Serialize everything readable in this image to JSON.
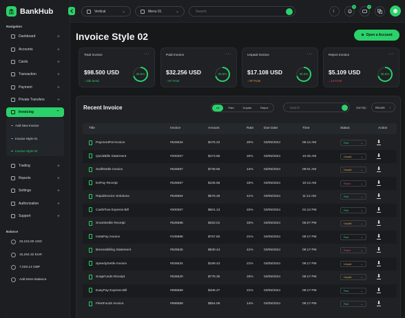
{
  "app": {
    "brand": "BankHub"
  },
  "sidebar": {
    "nav_title": "Navigation",
    "items": [
      {
        "label": "Dashboard",
        "icon": "dashboard-icon"
      },
      {
        "label": "Accounts",
        "icon": "accounts-icon"
      },
      {
        "label": "Cards",
        "icon": "card-icon"
      },
      {
        "label": "Transaction",
        "icon": "transaction-icon"
      },
      {
        "label": "Payment",
        "icon": "payment-icon"
      },
      {
        "label": "Private Transfers",
        "icon": "transfer-icon"
      },
      {
        "label": "Invoicing",
        "icon": "invoice-icon",
        "active": true
      },
      {
        "label": "Trading",
        "icon": "trading-icon"
      },
      {
        "label": "Reports",
        "icon": "reports-icon"
      },
      {
        "label": "Settings",
        "icon": "settings-icon"
      },
      {
        "label": "Authorization",
        "icon": "authorization-icon"
      },
      {
        "label": "Support",
        "icon": "support-icon"
      }
    ],
    "sub_items": [
      {
        "label": "Add New Invoice"
      },
      {
        "label": "Invoice Style 01"
      },
      {
        "label": "Invoice Style 02",
        "active": true
      }
    ],
    "balance_title": "Balance",
    "balances": [
      "33,215.00 USD",
      "15,254.32 EUR",
      "7,029.14 GBP"
    ],
    "add_balance": "Add More Balance"
  },
  "topbar": {
    "view_select": "Vertical",
    "menu_select": "Menu 01",
    "search_placeholder": "Search",
    "notif_count": "5",
    "msg_count": "4"
  },
  "page": {
    "title": "Invoice Style 02",
    "open_account": "Open a Account"
  },
  "cards": [
    {
      "title": "Total Invoice",
      "value": "$98.500 USD",
      "sub": "↑ 23k Send",
      "sub_color": "#2bd16a",
      "pct": "35.5%"
    },
    {
      "title": "Paid Invoice",
      "value": "$32.256 USD",
      "sub": "↑ 97 From",
      "sub_color": "#2bd16a",
      "pct": "35.5%"
    },
    {
      "title": "Unpaid Invoice",
      "value": "$17.108 USD",
      "sub": "↕ 97 From",
      "sub_color": "#e8a33a",
      "pct": "35.5%"
    },
    {
      "title": "Reject Invoice",
      "value": "$5.109 USD",
      "sub": "↓ 14 From",
      "sub_color": "#e5484d",
      "pct": "35.5%"
    }
  ],
  "recent": {
    "title": "Recent Invoice",
    "filters": [
      "All",
      "Paid",
      "Unpaid",
      "Reject"
    ],
    "search_placeholder": "Search",
    "sort_label": "Sort By :",
    "sort_value": "Recent",
    "columns": [
      "Title",
      "Invoice",
      "Amount",
      "Rate",
      "Due Date",
      "Time",
      "Status",
      "Action"
    ],
    "rows": [
      {
        "title": "PaymentPal Invoice",
        "invoice": "#526534",
        "amount": "$475.22",
        "rate": "20%",
        "due": "03/05/2024",
        "time": "05:12 AM",
        "status": "Paid"
      },
      {
        "title": "QuickBills Statement",
        "invoice": "#200257",
        "amount": "$473.85",
        "rate": "20%",
        "due": "03/05/2024",
        "time": "10:45 AM",
        "status": "Unpaid"
      },
      {
        "title": "SwiftSettle Invoice",
        "invoice": "#526587",
        "amount": "$739.65",
        "rate": "14%",
        "due": "03/05/2024",
        "time": "09:01 AM",
        "status": "Unpaid"
      },
      {
        "title": "E2Pay Receipt",
        "invoice": "#526587",
        "amount": "$106.58",
        "rate": "33%",
        "due": "03/05/2024",
        "time": "10:12 AM",
        "status": "Reject"
      },
      {
        "title": "RapidInvoice Solutions",
        "invoice": "#526584",
        "amount": "$576.28",
        "rate": "41%",
        "due": "03/05/2024",
        "time": "11:12 AM",
        "status": "Paid"
      },
      {
        "title": "CashFlow Express Bill",
        "invoice": "#200257",
        "amount": "$601.13",
        "rate": "22%",
        "due": "03/05/2024",
        "time": "01:12 PM",
        "status": "Paid"
      },
      {
        "title": "SmartSettle Receipt",
        "invoice": "#526588",
        "amount": "$263.01",
        "rate": "33%",
        "due": "03/05/2024",
        "time": "05:07 PM",
        "status": "Unpaid"
      },
      {
        "title": "InstaPay Invoice",
        "invoice": "#105986",
        "amount": "$767.50",
        "rate": "21%",
        "due": "02/05/2024",
        "time": "09:17 PM",
        "status": "Paid"
      },
      {
        "title": "BreezeBilling Statement",
        "invoice": "#526525",
        "amount": "$630.44",
        "rate": "41%",
        "due": "03/05/2024",
        "time": "09:17 PM",
        "status": "Reject"
      },
      {
        "title": "SpeedySettle Invoice",
        "invoice": "#526534",
        "amount": "$169.43",
        "rate": "21%",
        "due": "03/05/2024",
        "time": "09:17 PM",
        "status": "Unpaid"
      },
      {
        "title": "SnapFunds Receipt",
        "invoice": "#526520",
        "amount": "$778.35",
        "rate": "33%",
        "due": "03/05/2024",
        "time": "09:17 PM",
        "status": "Unpaid"
      },
      {
        "title": "EasyPay Express Bill",
        "invoice": "#696589",
        "amount": "$406.27",
        "rate": "21%",
        "due": "03/05/2024",
        "time": "09:17 PM",
        "status": "Paid"
      },
      {
        "title": "FleetFunds Invoice",
        "invoice": "#696589",
        "amount": "$854.09",
        "rate": "14%",
        "due": "03/05/2024",
        "time": "09:17 PM",
        "status": "Paid"
      }
    ],
    "status_colors": {
      "Paid": "#2bd16a",
      "Unpaid": "#e8a33a",
      "Reject": "#e5484d"
    }
  }
}
